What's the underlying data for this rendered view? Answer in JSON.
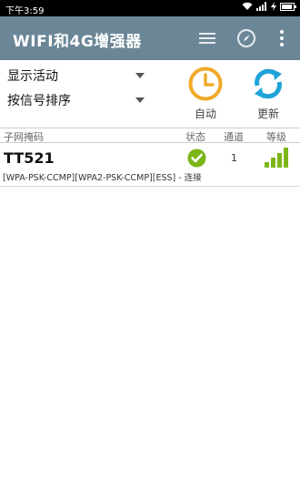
{
  "status_bar": {
    "time": "下午3:59"
  },
  "app_bar": {
    "title": "WIFI和4G增强器",
    "actions": [
      "list-icon",
      "compass-icon",
      "overflow-menu-icon"
    ]
  },
  "controls": {
    "dropdown_filter": "显示活动",
    "dropdown_sort": "按信号排序",
    "auto_label": "自动",
    "refresh_label": "更新"
  },
  "table": {
    "headers": {
      "ssid": "子网掩码",
      "state": "状态",
      "channel": "通道",
      "level": "等级"
    },
    "rows": [
      {
        "ssid": "TT521",
        "capabilities": "[WPA-PSK-CCMP][WPA2-PSK-CCMP][ESS] - 连接",
        "state": "connected",
        "channel": "1",
        "signal_bars_total": 4,
        "signal_bars_filled": 4
      }
    ]
  },
  "colors": {
    "app_bar": "#6b8797",
    "accent_orange": "#f0a92a",
    "accent_blue": "#1fa3d9",
    "signal_green": "#7cb518"
  }
}
